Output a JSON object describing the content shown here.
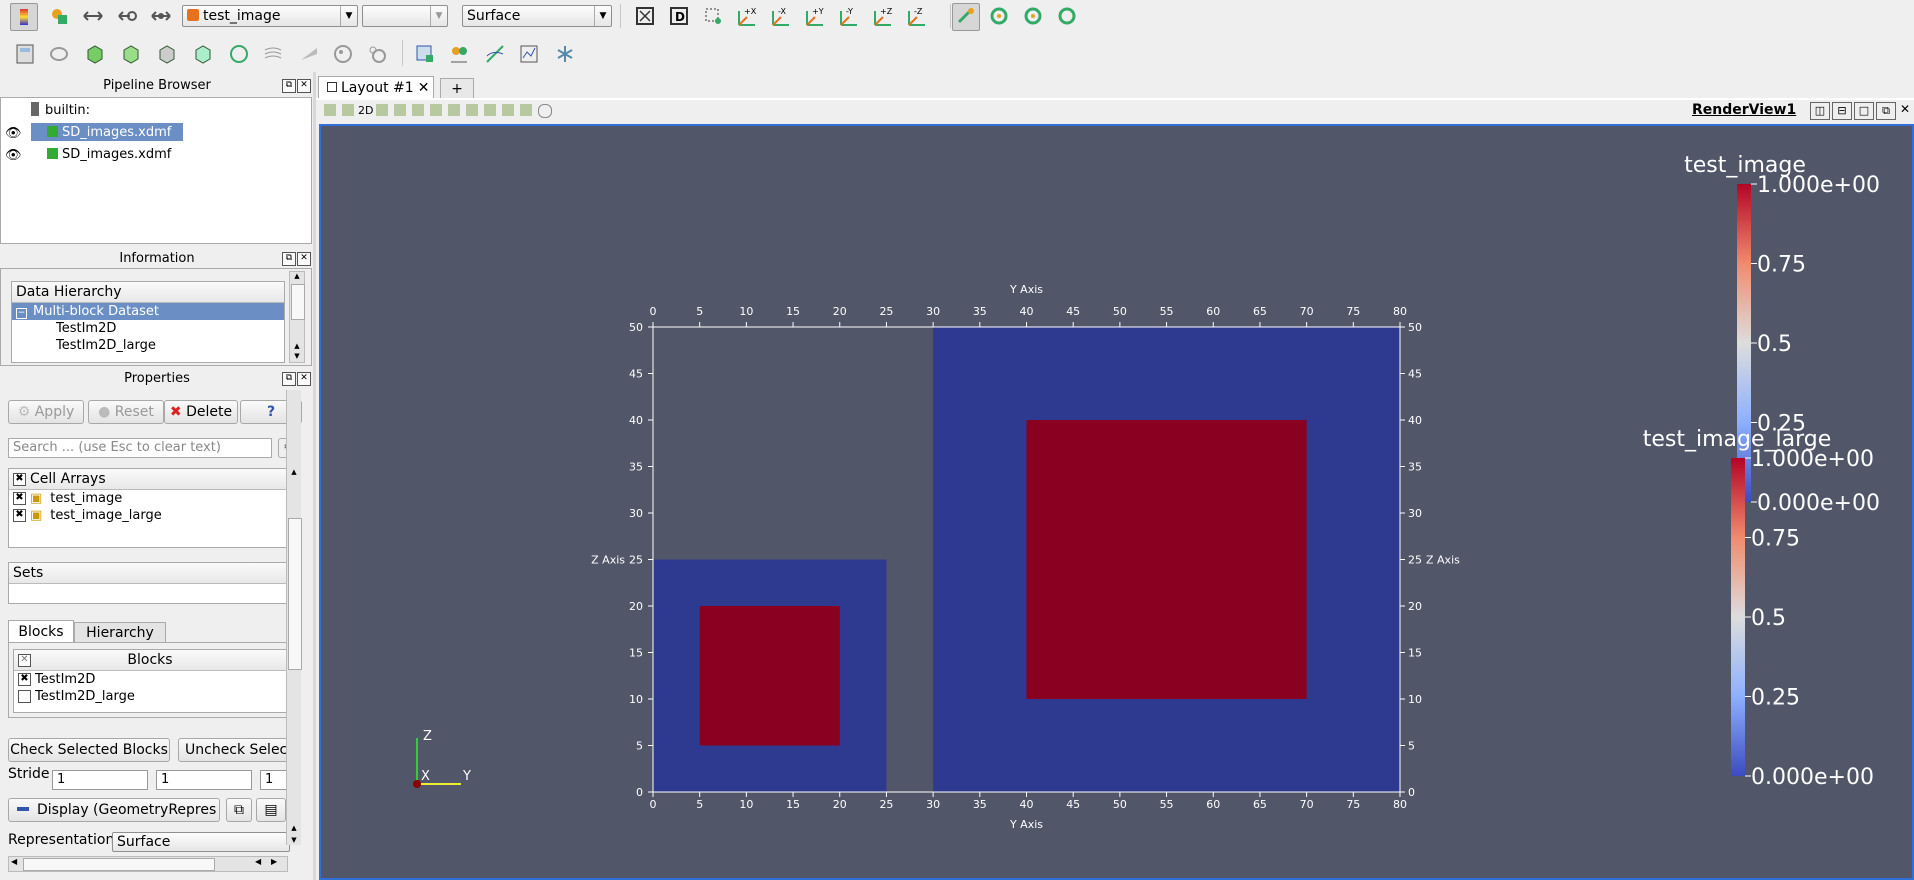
{
  "toolbar1": {
    "source_combo": "test_image",
    "empty_combo": "",
    "representation_combo": "Surface",
    "camera_labels": [
      "+X",
      "-X",
      "+Y",
      "-Y",
      "+Z",
      "-Z"
    ]
  },
  "toolbar2": {},
  "pipeline": {
    "title": "Pipeline Browser",
    "root": "builtin:",
    "items": [
      "SD_images.xdmf",
      "SD_images.xdmf"
    ]
  },
  "information": {
    "title": "Information",
    "header": "Data Hierarchy",
    "root": "Multi-block Dataset",
    "children": [
      "TestIm2D",
      "TestIm2D_large"
    ]
  },
  "properties": {
    "title": "Properties",
    "apply": "Apply",
    "reset": "Reset",
    "delete": "Delete",
    "help": "?",
    "search_placeholder": "Search ... (use Esc to clear text)",
    "cell_arrays_header": "Cell Arrays",
    "cell_arrays": [
      "test_image",
      "test_image_large"
    ],
    "sets_header": "Sets",
    "tabs": [
      "Blocks",
      "Hierarchy"
    ],
    "blocks_header": "Blocks",
    "blocks": [
      {
        "label": "TestIm2D",
        "checked": true
      },
      {
        "label": "TestIm2D_large",
        "checked": false
      }
    ],
    "check_selected": "Check Selected Blocks",
    "uncheck_selected": "Uncheck Select",
    "stride_label": "Stride",
    "stride_values": [
      "1",
      "1",
      "1"
    ],
    "display_label": "Display (GeometryRepres",
    "representation_label": "Representation",
    "representation_value": "Surface"
  },
  "layout": {
    "tab_label": "Layout #1",
    "add_tab": "+",
    "view_2d": "2D",
    "view_name": "RenderView1"
  },
  "render": {
    "y_axis_label": "Y Axis",
    "z_axis_label": "Z Axis",
    "y_ticks": [
      "0",
      "5",
      "10",
      "15",
      "20",
      "25",
      "30",
      "35",
      "40",
      "45",
      "50",
      "55",
      "60",
      "65",
      "70",
      "75",
      "80"
    ],
    "z_ticks": [
      "0",
      "5",
      "10",
      "15",
      "20",
      "25",
      "30",
      "35",
      "40",
      "45",
      "50"
    ],
    "orientation": {
      "z": "Z",
      "x": "X",
      "y": "Y"
    },
    "colors": {
      "background": "#515669",
      "blue": "#2e3a8f",
      "red": "#8a0021"
    },
    "legend1": {
      "title": "test_image",
      "max": "1.000e+00",
      "v075": "0.75",
      "v05": "0.5",
      "v025": "0.25",
      "min": "0.000e+00"
    },
    "legend2": {
      "title": "test_image_large",
      "max": "1.000e+00",
      "v075": "0.75",
      "v05": "0.5",
      "v025": "0.25",
      "min": "0.000e+00"
    }
  }
}
